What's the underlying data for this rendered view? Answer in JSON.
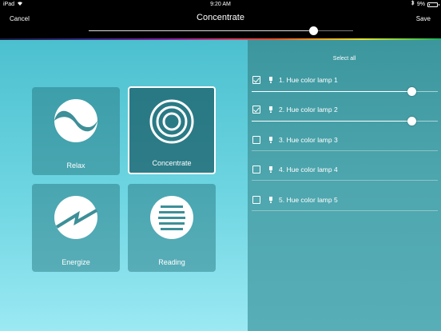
{
  "status_bar": {
    "device": "iPad",
    "time": "9:20 AM",
    "battery_text": "9%",
    "battery_level": 0.09
  },
  "navbar": {
    "cancel_label": "Cancel",
    "title": "Concentrate",
    "save_label": "Save",
    "master_brightness": 0.85
  },
  "scenes": [
    {
      "label": "Relax",
      "icon": "yin-yang-icon",
      "selected": false
    },
    {
      "label": "Concentrate",
      "icon": "concentric-circles-icon",
      "selected": true
    },
    {
      "label": "Energize",
      "icon": "energize-icon",
      "selected": false
    },
    {
      "label": "Reading",
      "icon": "horizontal-lines-icon",
      "selected": false
    }
  ],
  "lamps_panel": {
    "select_all_label": "Select all",
    "lamps": [
      {
        "name": "1. Hue color lamp 1",
        "checked": true,
        "brightness": 0.86
      },
      {
        "name": "2. Hue color lamp 2",
        "checked": true,
        "brightness": 0.86
      },
      {
        "name": "3. Hue color lamp 3",
        "checked": false,
        "brightness": null
      },
      {
        "name": "4. Hue color lamp 4",
        "checked": false,
        "brightness": null
      },
      {
        "name": "5. Hue color lamp 5",
        "checked": false,
        "brightness": null
      }
    ]
  },
  "colors": {
    "left_panel_top": "#4cc0cf",
    "right_panel": "#4ea6ae",
    "scene_tile_selected": "#195f69"
  }
}
